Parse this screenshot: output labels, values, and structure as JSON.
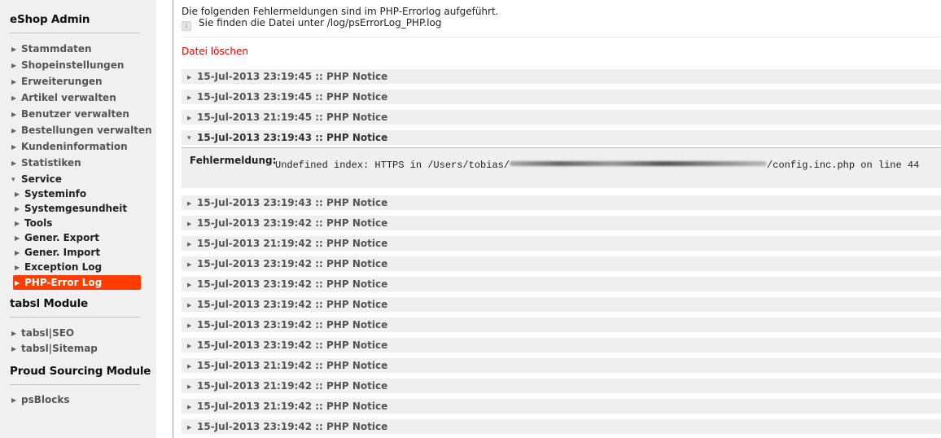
{
  "sidebar": {
    "sections": [
      {
        "title": "eShop Admin",
        "items": [
          {
            "label": "Stammdaten"
          },
          {
            "label": "Shopeinstellungen"
          },
          {
            "label": "Erweiterungen"
          },
          {
            "label": "Artikel verwalten"
          },
          {
            "label": "Benutzer verwalten"
          },
          {
            "label": "Bestellungen verwalten"
          },
          {
            "label": "Kundeninformation"
          },
          {
            "label": "Statistiken"
          },
          {
            "label": "Service",
            "expanded": true
          }
        ],
        "service_children": [
          {
            "label": "Systeminfo"
          },
          {
            "label": "Systemgesundheit"
          },
          {
            "label": "Tools"
          },
          {
            "label": "Gener. Export"
          },
          {
            "label": "Gener. Import"
          },
          {
            "label": "Exception Log"
          },
          {
            "label": "PHP-Error Log",
            "active": true
          }
        ]
      },
      {
        "title": "tabsl Module",
        "items": [
          {
            "label": "tabsl|SEO"
          },
          {
            "label": "tabsl|Sitemap"
          }
        ]
      },
      {
        "title": "Proud Sourcing Module",
        "items": [
          {
            "label": "psBlocks"
          }
        ]
      }
    ],
    "active_color": "#ff3d00"
  },
  "main": {
    "intro": "Die folgenden Fehlermeldungen sind im PHP-Errorlog aufgeführt.",
    "info_icon": "info-icon",
    "info_text": "Sie finden die Datei unter /log/psErrorLog_PHP.log",
    "delete_label": "Datei löschen",
    "delete_color": "#e00000",
    "entries": [
      {
        "label": "15-Jul-2013 23:19:45 :: PHP Notice",
        "expanded": false
      },
      {
        "label": "15-Jul-2013 23:19:45 :: PHP Notice",
        "expanded": false
      },
      {
        "label": "15-Jul-2013 21:19:45 :: PHP Notice",
        "expanded": false
      },
      {
        "label": "15-Jul-2013 23:19:43 :: PHP Notice",
        "expanded": true
      },
      {
        "label": "15-Jul-2013 23:19:43 :: PHP Notice",
        "expanded": false
      },
      {
        "label": "15-Jul-2013 23:19:42 :: PHP Notice",
        "expanded": false
      },
      {
        "label": "15-Jul-2013 21:19:42 :: PHP Notice",
        "expanded": false
      },
      {
        "label": "15-Jul-2013 23:19:42 :: PHP Notice",
        "expanded": false
      },
      {
        "label": "15-Jul-2013 23:19:42 :: PHP Notice",
        "expanded": false
      },
      {
        "label": "15-Jul-2013 23:19:42 :: PHP Notice",
        "expanded": false
      },
      {
        "label": "15-Jul-2013 23:19:42 :: PHP Notice",
        "expanded": false
      },
      {
        "label": "15-Jul-2013 23:19:42 :: PHP Notice",
        "expanded": false
      },
      {
        "label": "15-Jul-2013 21:19:42 :: PHP Notice",
        "expanded": false
      },
      {
        "label": "15-Jul-2013 21:19:42 :: PHP Notice",
        "expanded": false
      },
      {
        "label": "15-Jul-2013 21:19:42 :: PHP Notice",
        "expanded": false
      },
      {
        "label": "15-Jul-2013 23:19:42 :: PHP Notice",
        "expanded": false
      }
    ],
    "detail": {
      "label": "Fehlermeldung:",
      "message_prefix": "Undefined index: HTTPS in /Users/tobias/",
      "message_suffix": "/config.inc.php on line 44"
    }
  }
}
